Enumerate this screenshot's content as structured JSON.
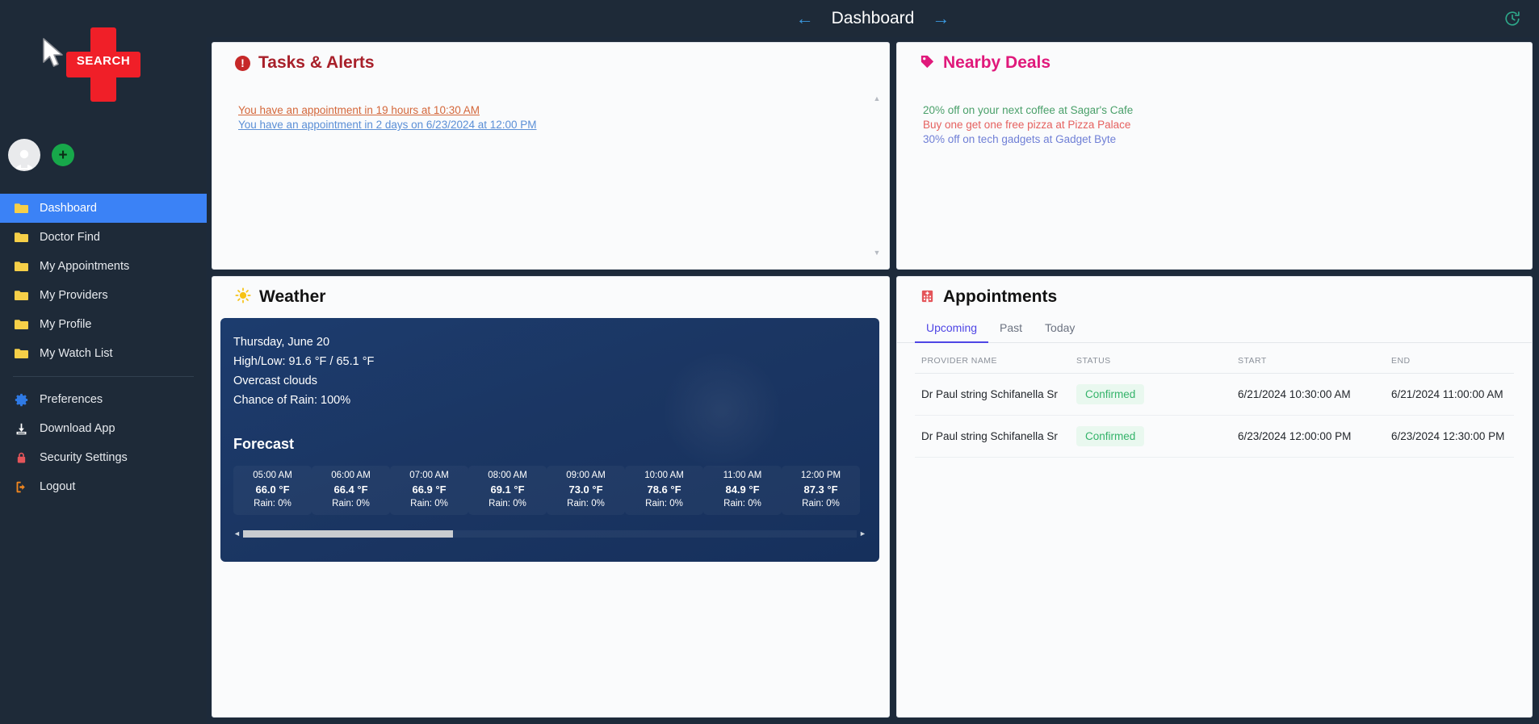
{
  "brand": {
    "logo_text": "SEARCH",
    "logo_color": "#f01f28"
  },
  "topbar": {
    "back_icon": "arrow-left-icon",
    "forward_icon": "arrow-right-icon",
    "title": "Dashboard",
    "history_icon": "clock-refresh-icon"
  },
  "sidebar": {
    "add_label": "+",
    "items": [
      {
        "label": "Dashboard",
        "icon": "folder-icon",
        "active": true
      },
      {
        "label": "Doctor Find",
        "icon": "folder-icon",
        "active": false
      },
      {
        "label": "My Appointments",
        "icon": "folder-icon",
        "active": false
      },
      {
        "label": "My Providers",
        "icon": "folder-icon",
        "active": false
      },
      {
        "label": "My Profile",
        "icon": "folder-icon",
        "active": false
      },
      {
        "label": "My Watch List",
        "icon": "folder-icon",
        "active": false
      }
    ],
    "secondary_items": [
      {
        "label": "Preferences",
        "icon": "gear-icon"
      },
      {
        "label": "Download App",
        "icon": "download-icon"
      },
      {
        "label": "Security Settings",
        "icon": "lock-icon"
      },
      {
        "label": "Logout",
        "icon": "logout-icon"
      }
    ]
  },
  "tasks": {
    "title": "Tasks & Alerts",
    "icon": "alert-circle-icon",
    "items": [
      {
        "text": "You have an appointment in 19 hours at 10:30 AM",
        "color": "#d4673a"
      },
      {
        "text": "You have an appointment in 2 days on 6/23/2024 at 12:00 PM",
        "color": "#5b8fd6"
      }
    ]
  },
  "deals": {
    "title": "Nearby Deals",
    "icon": "tag-icon",
    "items": [
      {
        "text": "20% off on your next coffee at Sagar's Cafe",
        "color": "#4aa06a"
      },
      {
        "text": "Buy one get one free pizza at Pizza Palace",
        "color": "#e5615f"
      },
      {
        "text": "30% off on tech gadgets at Gadget Byte",
        "color": "#6f7fd6"
      }
    ]
  },
  "weather": {
    "title": "Weather",
    "icon": "sun-icon",
    "date": "Thursday, June 20",
    "highlow": "High/Low: 91.6 °F / 65.1 °F",
    "conditions": "Overcast clouds",
    "rain": "Chance of Rain: 100%",
    "forecast_title": "Forecast",
    "forecast": [
      {
        "time": "05:00 AM",
        "temp": "66.0 °F",
        "rain": "Rain: 0%"
      },
      {
        "time": "06:00 AM",
        "temp": "66.4 °F",
        "rain": "Rain: 0%"
      },
      {
        "time": "07:00 AM",
        "temp": "66.9 °F",
        "rain": "Rain: 0%"
      },
      {
        "time": "08:00 AM",
        "temp": "69.1 °F",
        "rain": "Rain: 0%"
      },
      {
        "time": "09:00 AM",
        "temp": "73.0 °F",
        "rain": "Rain: 0%"
      },
      {
        "time": "10:00 AM",
        "temp": "78.6 °F",
        "rain": "Rain: 0%"
      },
      {
        "time": "11:00 AM",
        "temp": "84.9 °F",
        "rain": "Rain: 0%"
      },
      {
        "time": "12:00 PM",
        "temp": "87.3 °F",
        "rain": "Rain: 0%"
      }
    ]
  },
  "appointments": {
    "title": "Appointments",
    "icon": "hospital-icon",
    "tabs": [
      {
        "label": "Upcoming",
        "active": true
      },
      {
        "label": "Past",
        "active": false
      },
      {
        "label": "Today",
        "active": false
      }
    ],
    "columns": [
      "PROVIDER NAME",
      "STATUS",
      "START",
      "END"
    ],
    "rows": [
      {
        "provider": "Dr Paul string Schifanella Sr",
        "status": "Confirmed",
        "start": "6/21/2024 10:30:00 AM",
        "end": "6/21/2024 11:00:00 AM"
      },
      {
        "provider": "Dr Paul string Schifanella Sr",
        "status": "Confirmed",
        "start": "6/23/2024 12:00:00 PM",
        "end": "6/23/2024 12:30:00 PM"
      }
    ],
    "status_color": "#34b36a"
  }
}
